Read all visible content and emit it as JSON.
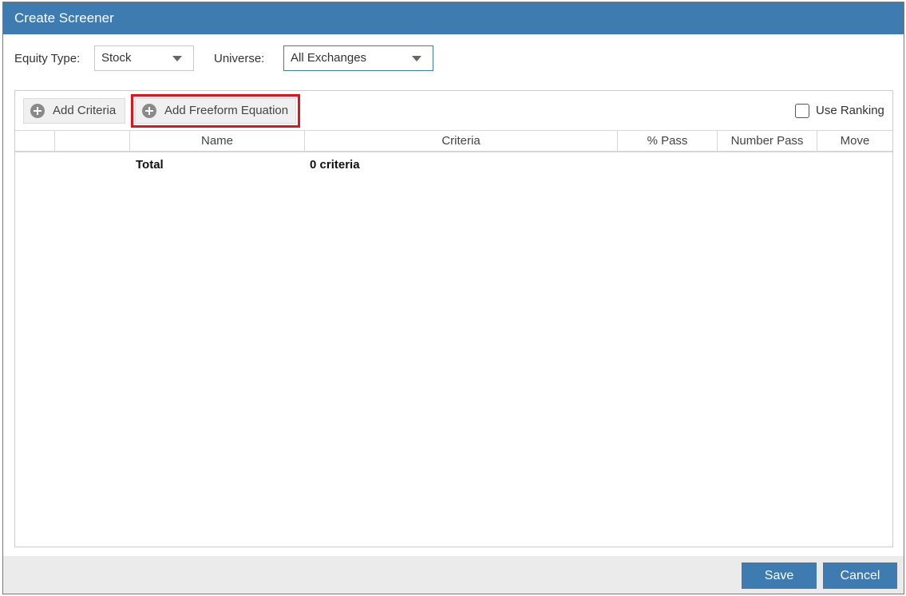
{
  "dialog": {
    "title": "Create Screener"
  },
  "filters": {
    "equity_type_label": "Equity Type:",
    "equity_type_value": "Stock",
    "universe_label": "Universe:",
    "universe_value": "All Exchanges"
  },
  "toolbar": {
    "add_criteria_label": "Add Criteria",
    "add_freeform_label": "Add Freeform Equation",
    "use_ranking_label": "Use Ranking",
    "use_ranking_checked": false
  },
  "grid": {
    "columns": [
      "",
      "",
      "Name",
      "Criteria",
      "% Pass",
      "Number Pass",
      "Move"
    ],
    "total_row": {
      "name": "Total",
      "criteria": "0 criteria"
    }
  },
  "footer": {
    "save_label": "Save",
    "cancel_label": "Cancel"
  },
  "colors": {
    "accent": "#3e7bb0",
    "highlight": "#e0141e"
  }
}
